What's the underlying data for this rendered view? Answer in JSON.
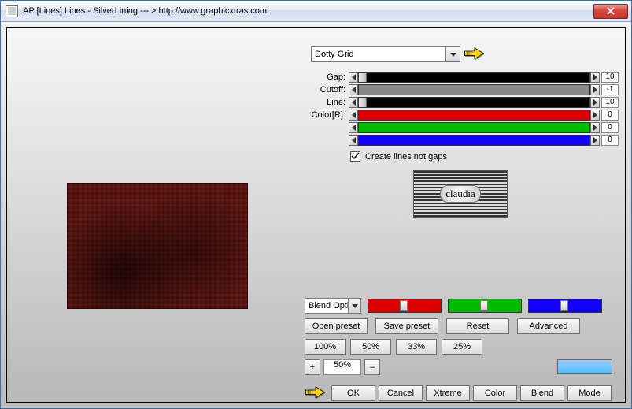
{
  "window": {
    "title": "AP [Lines]  Lines - SilverLining    --- >  http://www.graphicxtras.com"
  },
  "preset_dropdown": {
    "selected": "Dotty Grid"
  },
  "sliders": {
    "gap": {
      "label": "Gap:",
      "value": "10"
    },
    "cutoff": {
      "label": "Cutoff:",
      "value": "-1"
    },
    "line": {
      "label": "Line:",
      "value": "10"
    },
    "colorR": {
      "label": "Color[R]:",
      "value": "0"
    },
    "colorG": {
      "label": "",
      "value": "0"
    },
    "colorB": {
      "label": "",
      "value": "0"
    }
  },
  "checkbox": {
    "create_lines_label": "Create lines not gaps",
    "checked": true
  },
  "logo_text": "claudia",
  "blend_select": {
    "label": "Blend Opti"
  },
  "preset_buttons": {
    "open": "Open preset",
    "save": "Save preset",
    "reset": "Reset",
    "advanced": "Advanced"
  },
  "zoom_buttons": {
    "z100": "100%",
    "z50": "50%",
    "z33": "33%",
    "z25": "25%"
  },
  "pct": {
    "plus": "+",
    "value": "50%",
    "minus": "–"
  },
  "bottom_buttons": {
    "ok": "OK",
    "cancel": "Cancel",
    "xtreme": "Xtreme",
    "color": "Color",
    "blend": "Blend",
    "mode": "Mode"
  },
  "colors": {
    "swatch": "#66bbff"
  }
}
